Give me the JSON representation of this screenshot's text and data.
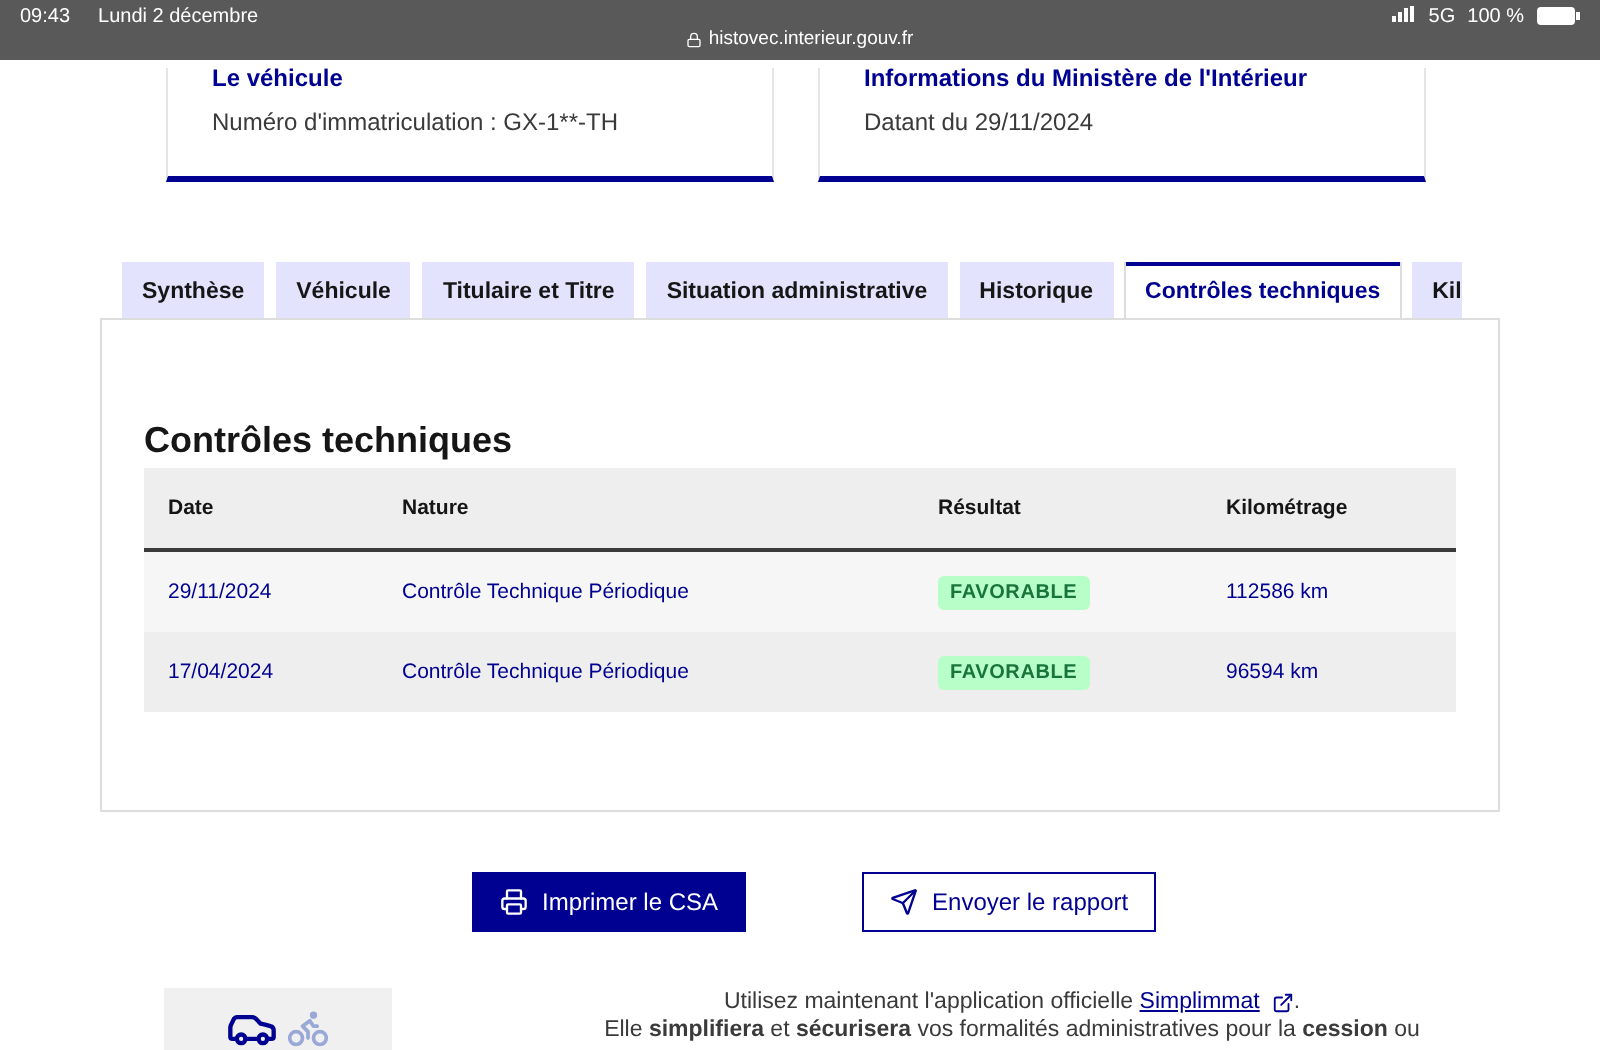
{
  "status_bar": {
    "time": "09:43",
    "date": "Lundi 2 décembre",
    "url": "histovec.interieur.gouv.fr",
    "network": "5G",
    "battery": "100 %"
  },
  "cards": [
    {
      "title": "Le véhicule",
      "text": "Numéro d'immatriculation : GX-1**-TH"
    },
    {
      "title": "Informations du Ministère de l'Intérieur",
      "text": "Datant du 29/11/2024"
    }
  ],
  "tabs": [
    {
      "label": "Synthèse",
      "selected": false
    },
    {
      "label": "Véhicule",
      "selected": false
    },
    {
      "label": "Titulaire et Titre",
      "selected": false
    },
    {
      "label": "Situation administrative",
      "selected": false
    },
    {
      "label": "Historique",
      "selected": false
    },
    {
      "label": "Contrôles techniques",
      "selected": true
    },
    {
      "label": "Kil",
      "selected": false
    }
  ],
  "section_title": "Contrôles techniques",
  "table": {
    "columns": [
      "Date",
      "Nature",
      "Résultat",
      "Kilométrage"
    ],
    "rows": [
      {
        "date": "29/11/2024",
        "nature": "Contrôle Technique Périodique",
        "result": "FAVORABLE",
        "km": "112586 km"
      },
      {
        "date": "17/04/2024",
        "nature": "Contrôle Technique Périodique",
        "result": "FAVORABLE",
        "km": "96594 km"
      }
    ]
  },
  "buttons": [
    {
      "kind": "primary",
      "label": "Imprimer le CSA"
    },
    {
      "kind": "secondary",
      "label": "Envoyer le rapport"
    }
  ],
  "promo": {
    "before": "Utilisez maintenant l'application officielle",
    "link": "Simplimmat",
    "after": ".",
    "line2": "Elle **simplifiera** et **sécurisera** vos formalités administratives pour la **cession** ou"
  }
}
